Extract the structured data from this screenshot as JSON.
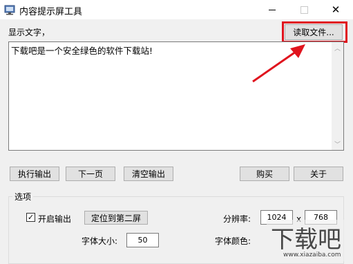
{
  "window": {
    "title": "内容提示屏工具",
    "min_icon": "minimize-icon",
    "max_icon": "maximize-icon",
    "close_icon": "close-icon",
    "close_glyph": "✕"
  },
  "top": {
    "display_label": "显示文字，",
    "read_file_button": "读取文件..."
  },
  "textarea": {
    "value": "下载吧是一个安全绿色的软件下载站!"
  },
  "actions": {
    "execute": "执行输出",
    "next_page": "下一页",
    "clear": "清空输出",
    "buy": "购买",
    "about": "关于"
  },
  "options": {
    "group_title": "选项",
    "enable_output_label": "开启输出",
    "enable_output_checked": true,
    "checkmark": "✓",
    "locate_second_screen": "定位到第二屏",
    "resolution_label": "分辨率:",
    "resolution_width": "1024",
    "resolution_sep": "x",
    "resolution_height": "768",
    "font_size_label": "字体大小:",
    "font_size_value": "50",
    "font_color_label": "字体颜色:"
  },
  "watermark": {
    "site": "www.xiazaiba.com"
  },
  "colors": {
    "highlight": "#e0141e",
    "arrow": "#e0141e"
  }
}
